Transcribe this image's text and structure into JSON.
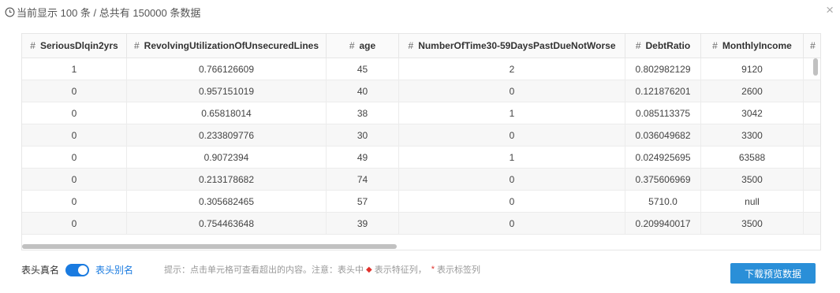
{
  "header": {
    "text": "当前显示 100 条 / 总共有 150000 条数据",
    "close_glyph": "×"
  },
  "table": {
    "hash_symbol": "#",
    "columns": [
      "SeriousDlqin2yrs",
      "RevolvingUtilizationOfUnsecuredLines",
      "age",
      "NumberOfTime30-59DaysPastDueNotWorse",
      "DebtRatio",
      "MonthlyIncome",
      ""
    ],
    "rows": [
      [
        "1",
        "0.766126609",
        "45",
        "2",
        "0.802982129",
        "9120"
      ],
      [
        "0",
        "0.957151019",
        "40",
        "0",
        "0.121876201",
        "2600"
      ],
      [
        "0",
        "0.65818014",
        "38",
        "1",
        "0.085113375",
        "3042"
      ],
      [
        "0",
        "0.233809776",
        "30",
        "0",
        "0.036049682",
        "3300"
      ],
      [
        "0",
        "0.9072394",
        "49",
        "1",
        "0.024925695",
        "63588"
      ],
      [
        "0",
        "0.213178682",
        "74",
        "0",
        "0.375606969",
        "3500"
      ],
      [
        "0",
        "0.305682465",
        "57",
        "0",
        "5710.0",
        "null"
      ],
      [
        "0",
        "0.754463648",
        "39",
        "0",
        "0.209940017",
        "3500"
      ]
    ]
  },
  "footer": {
    "true_name_label": "表头真名",
    "alias_label": "表头别名",
    "hint_prefix": "提示：点击单元格可查看超出的内容。注意：表头中",
    "hint_feature": "表示特征列，",
    "hint_star": "*",
    "hint_label_col": "表示标签列",
    "download_label": "下载预览数据"
  },
  "colors": {
    "accent": "#1a7be0",
    "button": "#2a8fd8",
    "marker": "#e0312b"
  }
}
